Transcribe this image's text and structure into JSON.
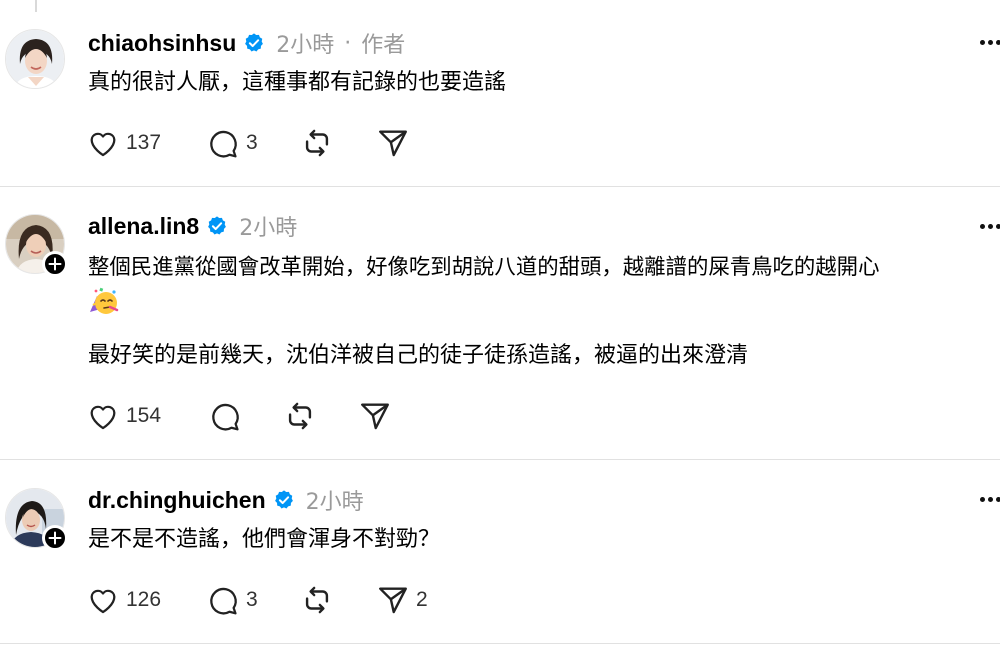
{
  "posts": [
    {
      "username": "chiaohsinhsu",
      "verified": true,
      "time": "2小時",
      "separator": "·",
      "author_tag": "作者",
      "lines": [
        "真的很討人厭，這種事都有記錄的也要造謠"
      ],
      "likes": "137",
      "replies": "3",
      "shares": ""
    },
    {
      "username": "allena.lin8",
      "verified": true,
      "time": "2小時",
      "lines": [
        "整個民進黨從國會改革開始，好像吃到胡說八道的甜頭，越離譜的屎青鳥吃的越開心",
        "最好笑的是前幾天，沈伯洋被自己的徒子徒孫造謠，被逼的出來澄清"
      ],
      "emoji": "partying-face-emoji",
      "likes": "154",
      "replies": "",
      "shares": ""
    },
    {
      "username": "dr.chinghuichen",
      "verified": true,
      "time": "2小時",
      "lines": [
        "是不是不造謠，他們會渾身不對勁？"
      ],
      "likes": "126",
      "replies": "3",
      "shares": "2"
    }
  ],
  "colors": {
    "verified_blue": "#0095f6",
    "meta_gray": "#9a9a9a",
    "divider": "#e1e1e1",
    "text": "#000000"
  }
}
